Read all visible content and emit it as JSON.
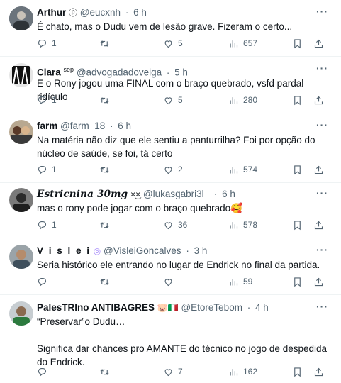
{
  "tweets": [
    {
      "name": "Arthur",
      "name_extra": "ⓟ",
      "handle": "@eucxnh",
      "time": "6 h",
      "text": "É chato, mas o Dudu vem de lesão grave. Fizeram o certo...",
      "replies": "1",
      "retweets": "",
      "likes": "5",
      "views": "657",
      "avatar": "avatar-arthur"
    },
    {
      "name": "Clara",
      "name_extra": "sep",
      "handle": "@advogadadoveiga",
      "time": "5 h",
      "text": "E o Rony jogou uma FINAL com o braço quebrado, vsfd pardal ridículo",
      "replies": "1",
      "retweets": "",
      "likes": "5",
      "views": "280",
      "avatar": "avatar-clara"
    },
    {
      "name": "farm",
      "name_extra": "",
      "handle": "@farm_18",
      "time": "6 h",
      "text": "Na matéria não diz que ele sentiu a panturrilha? Foi por opção do núcleo de saúde, se foi, tá certo",
      "replies": "1",
      "retweets": "",
      "likes": "2",
      "views": "574",
      "avatar": "avatar-farm"
    },
    {
      "name": "𝑬𝒔𝒕𝒓𝒊𝒄𝒏𝒊𝒏𝒂 30mg",
      "name_extra": "×͜×",
      "handle": "@lukasgabri3l_",
      "time": "6 h",
      "text": "mas o rony pode jogar com o braço quebrado🥰",
      "replies": "1",
      "retweets": "",
      "likes": "36",
      "views": "578",
      "avatar": "avatar-estricnina"
    },
    {
      "name": "V i s l e i",
      "name_extra": "◎",
      "handle": "@VisleiGoncalves",
      "time": "3 h",
      "text": "Seria histórico ele entrando no lugar de Endrick no final da partida.",
      "replies": "",
      "retweets": "",
      "likes": "",
      "views": "59",
      "avatar": "avatar-vislei"
    },
    {
      "name": "PalesTRIno ANTIBAGRES",
      "name_extra": "🐷🇮🇹",
      "handle": "@EtoreTebom",
      "time": "4 h",
      "text": "“Preservar”o Dudu…\n\nSignifica dar chances pro AMANTE do técnico no jogo de despedida do Endrick.",
      "replies": "",
      "retweets": "",
      "likes": "7",
      "views": "162",
      "avatar": "avatar-palestrino"
    }
  ],
  "colors": {
    "text": "#0f1419",
    "secondary": "#536471",
    "divider": "#eff3f4"
  },
  "icons": [
    "more-icon",
    "reply-icon",
    "retweet-icon",
    "like-icon",
    "views-icon",
    "bookmark-icon",
    "share-icon"
  ]
}
